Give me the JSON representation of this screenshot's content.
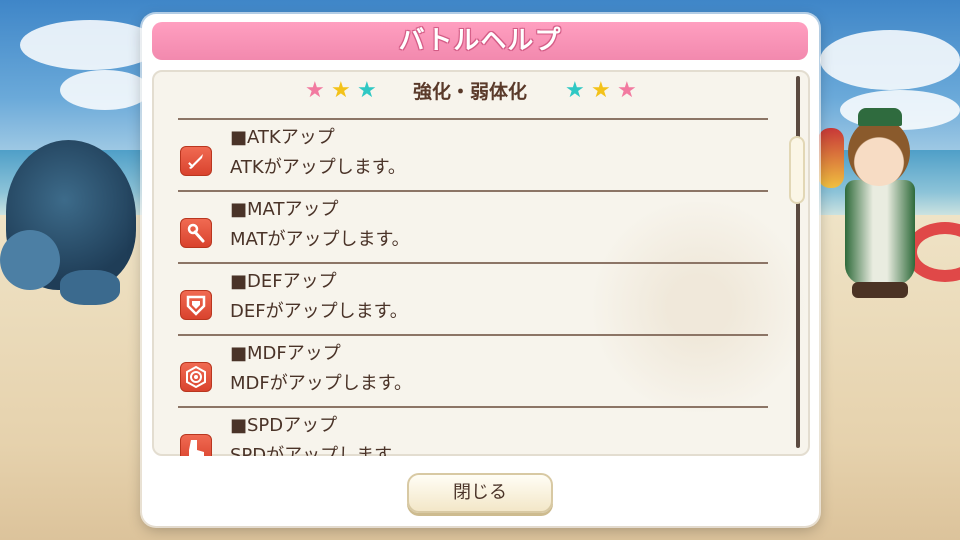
{
  "dialog": {
    "title": "バトルヘルプ",
    "section": {
      "title": "強化・弱体化",
      "stars_left": [
        "pink",
        "yellow",
        "cyan"
      ],
      "stars_right": [
        "cyan",
        "yellow",
        "pink"
      ],
      "star_glyph": "★",
      "star_colors": {
        "pink": "#f27aa0",
        "yellow": "#f3c21a",
        "cyan": "#2fc8c4"
      }
    },
    "items": [
      {
        "name": "■ATKアップ",
        "desc": "ATKがアップします。",
        "icon": "sword-icon"
      },
      {
        "name": "■MATアップ",
        "desc": "MATがアップします。",
        "icon": "wand-icon"
      },
      {
        "name": "■DEFアップ",
        "desc": "DEFがアップします。",
        "icon": "shield-icon"
      },
      {
        "name": "■MDFアップ",
        "desc": "MDFがアップします。",
        "icon": "magic-shield-icon"
      },
      {
        "name": "■SPDアップ",
        "desc": "SPDがアップします。",
        "icon": "boot-icon"
      }
    ],
    "close_label": "閉じる"
  },
  "colors": {
    "title_bar": "#f289ae",
    "icon_red": "#e1503a",
    "text_brown": "#4a3328"
  }
}
